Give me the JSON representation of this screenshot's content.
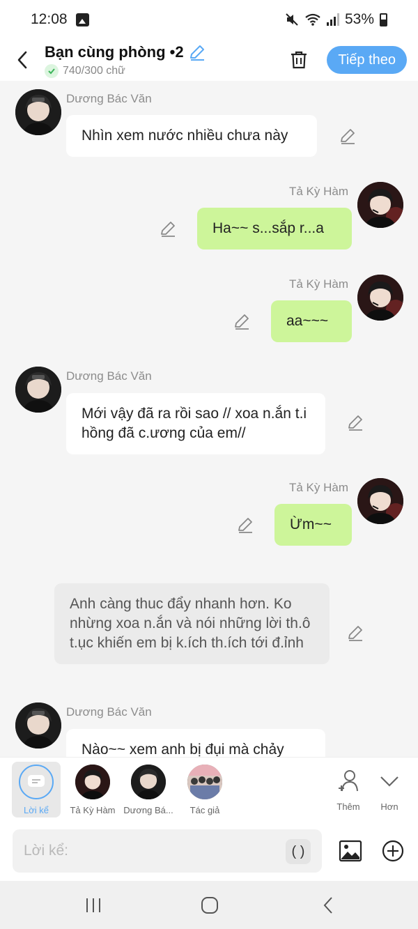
{
  "status_bar": {
    "time": "12:08",
    "battery": "53%"
  },
  "header": {
    "title": "Bạn cùng phòng •2",
    "word_count": "740/300 chữ",
    "next_label": "Tiếp theo"
  },
  "messages": [
    {
      "kind": "left",
      "sender": "Dương Bác Văn",
      "text": "Nhìn xem nước nhiều chưa này"
    },
    {
      "kind": "right",
      "sender": "Tả Kỳ Hàm",
      "text": "Ha~~ s...sắp r...a"
    },
    {
      "kind": "right",
      "sender": "Tả Kỳ Hàm",
      "text": "aa~~~"
    },
    {
      "kind": "left",
      "sender": "Dương Bác Văn",
      "text": "Mới vậy đã ra rồi sao // xoa n.ắn t.i hồng đã c.ương của em//"
    },
    {
      "kind": "right",
      "sender": "Tả Kỳ Hàm",
      "text": "Ừm~~"
    },
    {
      "kind": "narration",
      "text": "Anh càng thuc đẩy nhanh hơn. Ko nhừng xoa n.ắn và nói những lời th.ô t.ục khiến em bị k.ích th.ích tới đ.ỉnh"
    },
    {
      "kind": "left",
      "sender": "Dương Bác Văn",
      "text": "Nào~~ xem anh bị đụi mà chảy"
    }
  ],
  "toolbar": {
    "narrator_label": "Lời kể",
    "char1_label": "Tả Kỳ Hàm",
    "char2_label": "Dương Bá...",
    "author_label": "Tác giả",
    "add_label": "Thêm",
    "more_label": "Hơn"
  },
  "input": {
    "placeholder": "Lời kể:",
    "paren_label": "( )"
  },
  "colors": {
    "accent": "#5aa9f5",
    "right_bubble": "#cdf59a",
    "narration_bubble": "#ebebeb"
  }
}
